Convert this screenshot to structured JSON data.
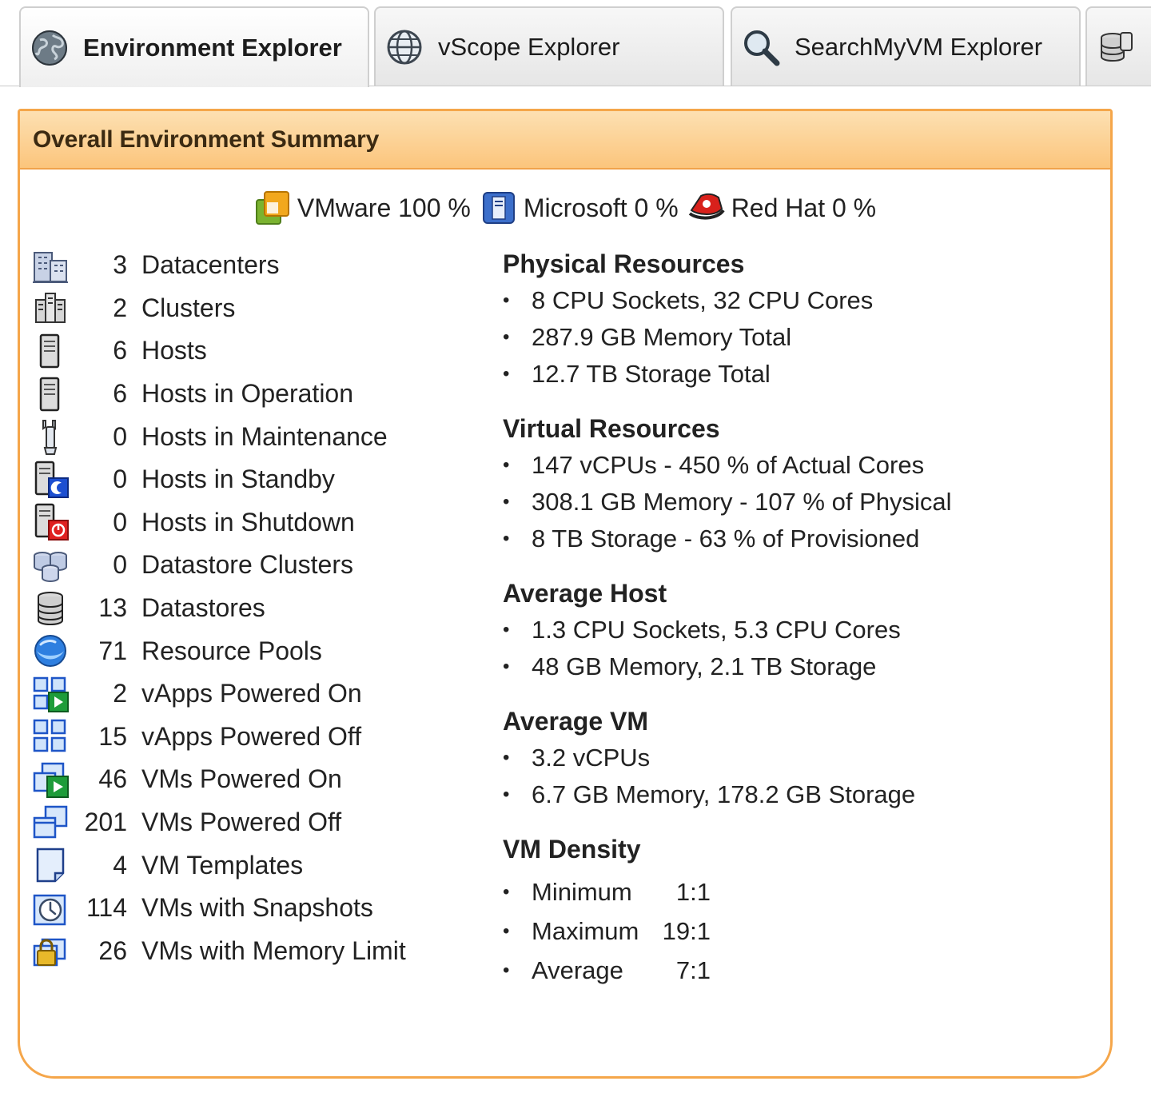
{
  "tabs": [
    {
      "label": "Environment Explorer",
      "icon": "globe-gear-icon",
      "active": true
    },
    {
      "label": "vScope Explorer",
      "icon": "globe-icon",
      "active": false
    },
    {
      "label": "SearchMyVM Explorer",
      "icon": "magnifier-icon",
      "active": false
    },
    {
      "label": "",
      "icon": "database-icon",
      "active": false
    }
  ],
  "panel": {
    "title": "Overall Environment Summary",
    "accent_color": "#f5a64a"
  },
  "vendors": [
    {
      "label": "VMware 100 %",
      "icon": "vmware-icon"
    },
    {
      "label": "Microsoft 0 %",
      "icon": "microsoft-server-icon"
    },
    {
      "label": "Red Hat 0 %",
      "icon": "redhat-icon"
    }
  ],
  "counts": [
    {
      "count": "3",
      "label": "Datacenters",
      "icon": "datacenter-icon"
    },
    {
      "count": "2",
      "label": "Clusters",
      "icon": "cluster-icon"
    },
    {
      "count": "6",
      "label": "Hosts",
      "icon": "host-icon"
    },
    {
      "count": "6",
      "label": "Hosts in Operation",
      "icon": "host-operation-icon"
    },
    {
      "count": "0",
      "label": "Hosts in Maintenance",
      "icon": "wrench-icon"
    },
    {
      "count": "0",
      "label": "Hosts in Standby",
      "icon": "host-standby-icon"
    },
    {
      "count": "0",
      "label": "Hosts in Shutdown",
      "icon": "host-shutdown-icon"
    },
    {
      "count": "0",
      "label": "Datastore Clusters",
      "icon": "datastore-cluster-icon"
    },
    {
      "count": "13",
      "label": "Datastores",
      "icon": "datastore-icon"
    },
    {
      "count": "71",
      "label": "Resource Pools",
      "icon": "resource-pool-icon"
    },
    {
      "count": "2",
      "label": "vApps Powered On",
      "icon": "vapp-on-icon"
    },
    {
      "count": "15",
      "label": "vApps Powered Off",
      "icon": "vapp-off-icon"
    },
    {
      "count": "46",
      "label": "VMs Powered On",
      "icon": "vm-on-icon"
    },
    {
      "count": "201",
      "label": "VMs Powered Off",
      "icon": "vm-off-icon"
    },
    {
      "count": "4",
      "label": "VM Templates",
      "icon": "vm-template-icon"
    },
    {
      "count": "114",
      "label": "VMs with Snapshots",
      "icon": "snapshot-icon"
    },
    {
      "count": "26",
      "label": "VMs with Memory Limit",
      "icon": "memory-limit-icon"
    }
  ],
  "physical": {
    "title": "Physical Resources",
    "items": [
      "8 CPU Sockets, 32 CPU Cores",
      "287.9 GB Memory Total",
      "12.7 TB Storage Total"
    ]
  },
  "virtual": {
    "title": "Virtual Resources",
    "items": [
      "147 vCPUs - 450 % of Actual Cores",
      "308.1 GB Memory - 107 % of Physical",
      "8 TB Storage - 63 % of Provisioned"
    ]
  },
  "avg_host": {
    "title": "Average Host",
    "items": [
      "1.3 CPU Sockets, 5.3 CPU Cores",
      "48 GB Memory, 2.1 TB Storage"
    ]
  },
  "avg_vm": {
    "title": "Average VM",
    "items": [
      "3.2 vCPUs",
      "6.7 GB Memory, 178.2 GB Storage"
    ]
  },
  "density": {
    "title": "VM Density",
    "items": [
      {
        "label": "Minimum",
        "value": "1:1"
      },
      {
        "label": "Maximum",
        "value": "19:1"
      },
      {
        "label": "Average",
        "value": "7:1"
      }
    ]
  }
}
